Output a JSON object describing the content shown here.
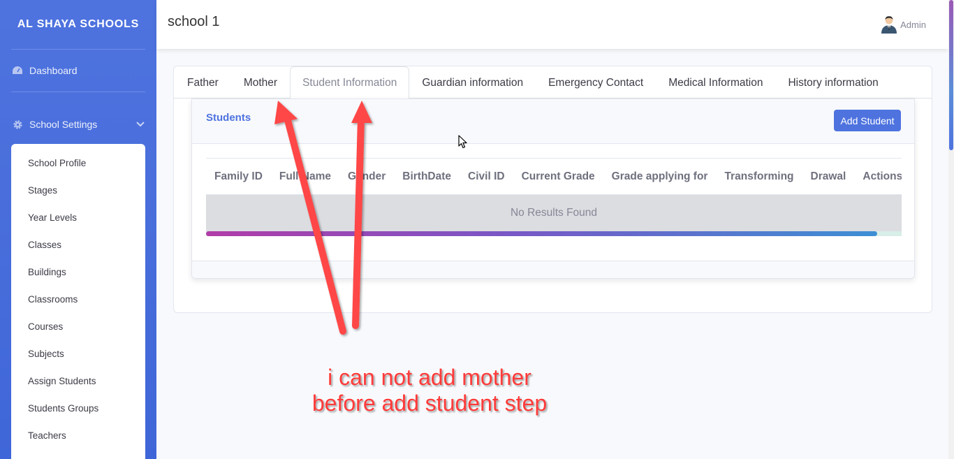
{
  "sidebar": {
    "brand": "AL SHAYA SCHOOLS",
    "dashboard": {
      "label": "Dashboard",
      "icon": "dashboard-icon"
    },
    "school_settings": {
      "label": "School Settings",
      "icon": "gear-icon"
    },
    "submenu": [
      "School Profile",
      "Stages",
      "Year Levels",
      "Classes",
      "Buildings",
      "Classrooms",
      "Courses",
      "Subjects",
      "Assign Students",
      "Students Groups",
      "Teachers"
    ]
  },
  "topbar": {
    "page_heading": "school 1",
    "user_name": "Admin"
  },
  "tabs": [
    "Father",
    "Mother",
    "Student Information",
    "Guardian information",
    "Emergency Contact",
    "Medical Information",
    "History information"
  ],
  "active_tab": "Student Information",
  "students_card": {
    "title": "Students",
    "add_button": "Add Student",
    "columns": [
      "Family ID",
      "Full Name",
      "Gender",
      "BirthDate",
      "Civil ID",
      "Current Grade",
      "Grade applying for",
      "Transforming",
      "Drawal",
      "Actions"
    ],
    "empty_message": "No Results Found"
  },
  "annotation": {
    "line1": "i can not add mother",
    "line2": "before add student step"
  },
  "colors": {
    "primary": "#4e73df",
    "annotation": "#ff3b3b"
  }
}
